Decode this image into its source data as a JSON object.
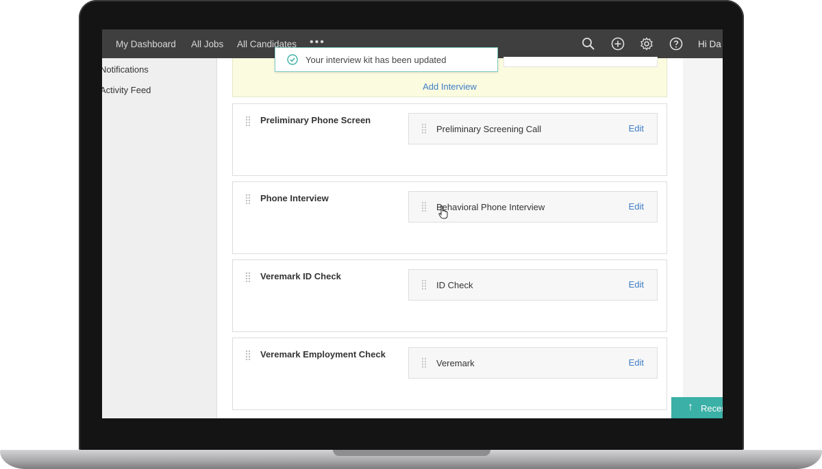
{
  "nav": {
    "links": [
      "My Dashboard",
      "All Jobs",
      "All Candidates"
    ],
    "more": "•••",
    "icons": [
      "search-icon",
      "add-circle-icon",
      "gear-icon",
      "help-icon"
    ],
    "greeting": "Hi Da"
  },
  "sidebar": {
    "items": [
      "Notifications",
      "Activity Feed"
    ]
  },
  "toast": {
    "message": "Your interview kit has been updated",
    "icon": "check-circle-icon",
    "border_color": "#7fcbc4"
  },
  "stages": {
    "add_interview": "Add Interview",
    "edit_label": "Edit",
    "items": [
      {
        "title": "Preliminary Phone Screen",
        "kit": "Preliminary Screening Call"
      },
      {
        "title": "Phone Interview",
        "kit": "Behavioral Phone Interview"
      },
      {
        "title": "Veremark ID Check",
        "kit": "ID Check"
      },
      {
        "title": "Veremark Employment Check",
        "kit": "Veremark"
      }
    ]
  },
  "recent": {
    "label": "Recen",
    "arrow": "↑"
  },
  "colors": {
    "accent_teal": "#3bb0a6",
    "link_blue": "#3d7dc5",
    "nav_bg": "#3f3f3f",
    "highlight_yellow": "#fbfbe0"
  }
}
